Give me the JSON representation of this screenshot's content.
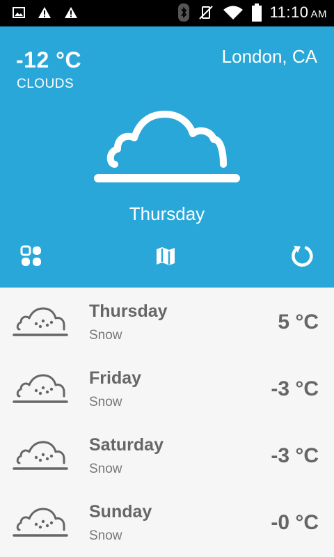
{
  "status_bar": {
    "time": "11:10",
    "ampm": "AM"
  },
  "header": {
    "temperature": "-12 °C",
    "condition": "CLOUDS",
    "city": "London, CA",
    "day": "Thursday",
    "icon": "cloud-icon"
  },
  "actions": [
    {
      "icon": "apps-grid-icon"
    },
    {
      "icon": "map-icon"
    },
    {
      "icon": "refresh-icon"
    }
  ],
  "forecast": [
    {
      "day": "Thursday",
      "condition": "Snow",
      "temp": "5 °C",
      "icon": "snow-cloud-icon"
    },
    {
      "day": "Friday",
      "condition": "Snow",
      "temp": "-3 °C",
      "icon": "snow-cloud-icon"
    },
    {
      "day": "Saturday",
      "condition": "Snow",
      "temp": "-3 °C",
      "icon": "snow-cloud-icon"
    },
    {
      "day": "Sunday",
      "condition": "Snow",
      "temp": "-0 °C",
      "icon": "snow-cloud-icon"
    }
  ]
}
